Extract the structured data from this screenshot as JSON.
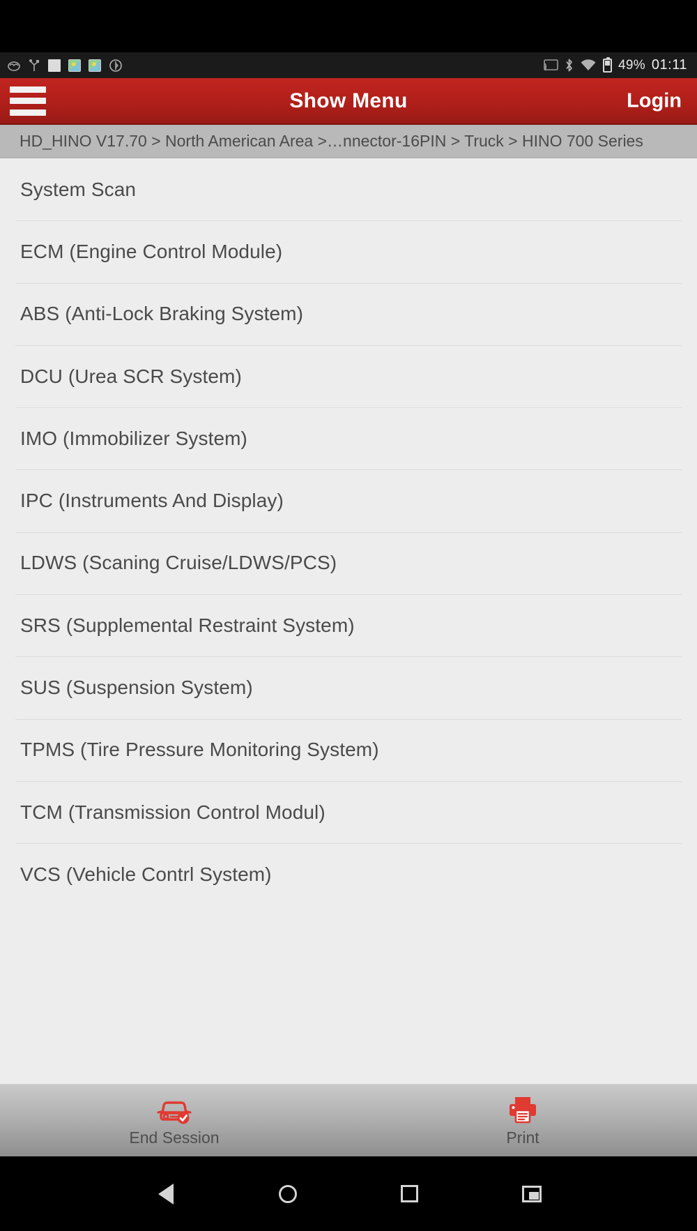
{
  "statusbar": {
    "left_icons": [
      "weather-icon",
      "usb-debug-icon",
      "blank-notification-icon",
      "gallery-icon",
      "gallery-icon-2",
      "bluetooth-sync-icon"
    ],
    "right_icons": [
      "cast-icon",
      "bluetooth-icon",
      "wifi-icon",
      "battery-icon"
    ],
    "battery_percent": "49%",
    "time": "01:11"
  },
  "appbar": {
    "menu_icon": "hamburger-menu-icon",
    "title": "Show Menu",
    "login_label": "Login",
    "background_color": "#b01f1a"
  },
  "breadcrumb": {
    "text": "HD_HINO V17.70 > North American Area >…nnector-16PIN > Truck > HINO 700 Series"
  },
  "menu": {
    "items": [
      {
        "label": "System Scan"
      },
      {
        "label": "ECM (Engine Control Module)"
      },
      {
        "label": "ABS (Anti-Lock Braking System)"
      },
      {
        "label": "DCU (Urea SCR System)"
      },
      {
        "label": "IMO (Immobilizer System)"
      },
      {
        "label": "IPC (Instruments And Display)"
      },
      {
        "label": "LDWS (Scaning Cruise/LDWS/PCS)"
      },
      {
        "label": "SRS (Supplemental Restraint System)"
      },
      {
        "label": "SUS (Suspension System)"
      },
      {
        "label": "TPMS (Tire Pressure Monitoring System)"
      },
      {
        "label": "TCM (Transmission Control Modul)"
      },
      {
        "label": "VCS (Vehicle Contrl System)"
      }
    ]
  },
  "toolbar": {
    "end_session": {
      "label": "End Session",
      "icon": "car-check-icon",
      "icon_color": "#e03a32"
    },
    "print": {
      "label": "Print",
      "icon": "printer-icon",
      "icon_color": "#e03a32"
    }
  },
  "navbar": {
    "buttons": [
      "back-icon",
      "home-icon",
      "recents-icon",
      "screenshot-icon"
    ]
  }
}
